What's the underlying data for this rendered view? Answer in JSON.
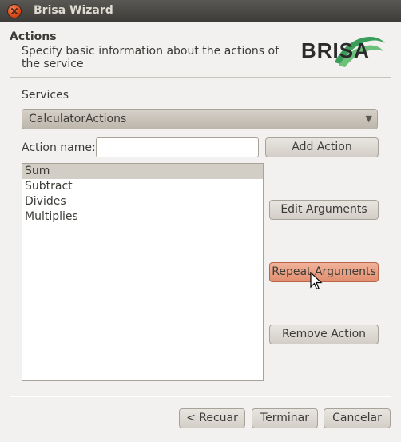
{
  "window": {
    "title": "Brisa Wizard"
  },
  "header": {
    "title": "Actions",
    "subtitle": "Specify basic information about the actions of the service",
    "logo_text": "BRISA"
  },
  "services": {
    "label": "Services",
    "selected": "CalculatorActions"
  },
  "action_name": {
    "label": "Action name:",
    "value": "",
    "add_label": "Add Action"
  },
  "actions": [
    "Sum",
    "Subtract",
    "Divides",
    "Multiplies"
  ],
  "selected_action": "Sum",
  "side_buttons": {
    "edit": "Edit Arguments",
    "repeat": "Repeat Arguments",
    "remove": "Remove Action"
  },
  "footer": {
    "back": "< Recuar",
    "finish": "Terminar",
    "cancel": "Cancelar"
  },
  "colors": {
    "accent": "#dd4814",
    "logo_green": "#3a9d5a"
  }
}
